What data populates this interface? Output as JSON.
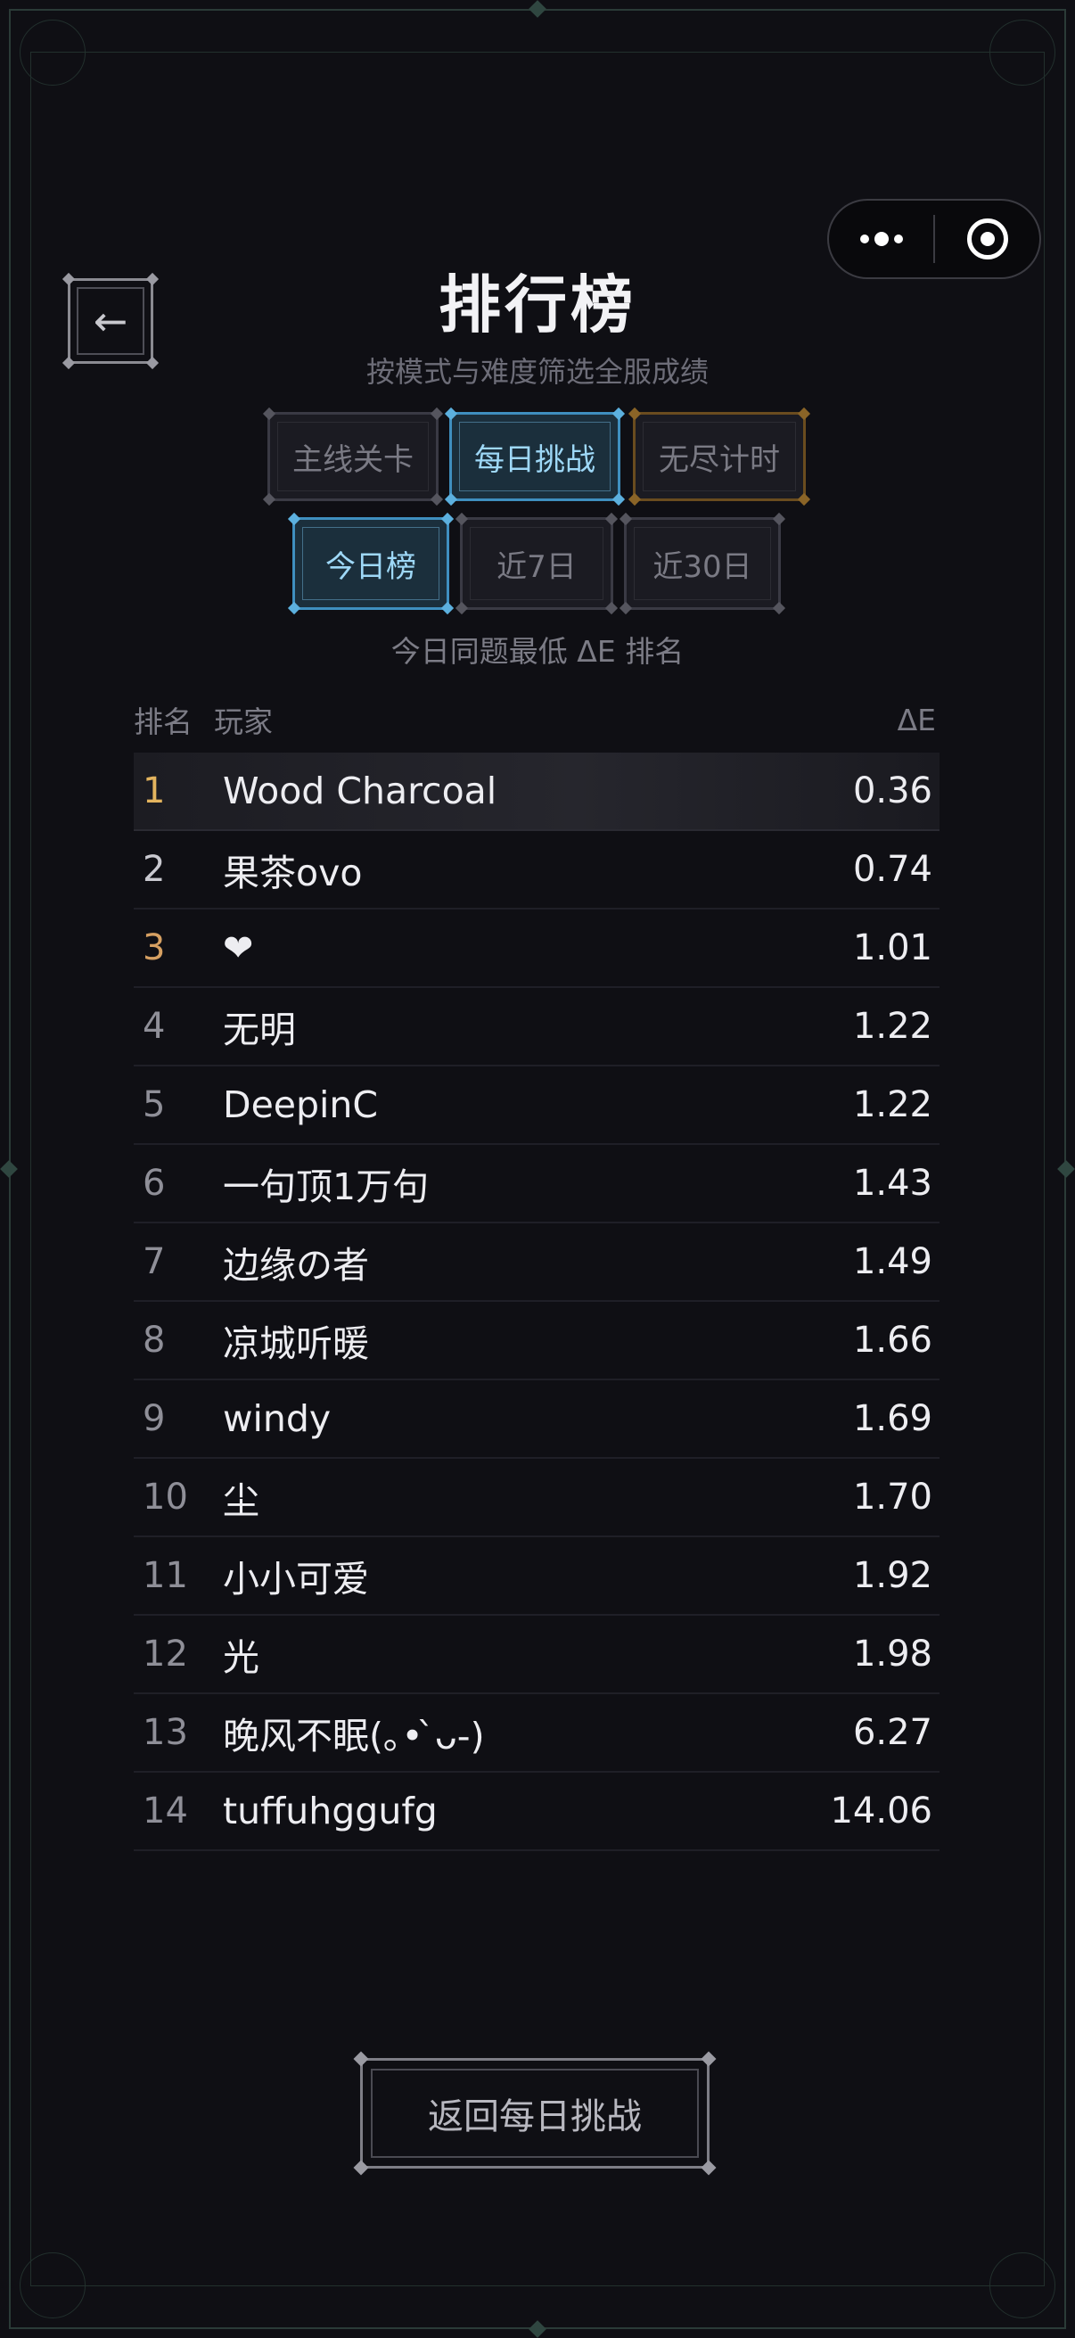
{
  "header": {
    "title": "排行榜",
    "subtitle": "按模式与难度筛选全服成绩",
    "back_icon": "←"
  },
  "mode_tabs": [
    {
      "label": "主线关卡",
      "active": false
    },
    {
      "label": "每日挑战",
      "active": true
    },
    {
      "label": "无尽计时",
      "active": false
    }
  ],
  "range_tabs": [
    {
      "label": "今日榜",
      "active": true
    },
    {
      "label": "近7日",
      "active": false
    },
    {
      "label": "近30日",
      "active": false
    }
  ],
  "range_caption": "今日同题最低 ΔE 排名",
  "table": {
    "headers": {
      "rank": "排名",
      "player": "玩家",
      "delta": "ΔE"
    },
    "rows": [
      {
        "rank": "1",
        "player": "Wood Charcoal",
        "delta": "0.36"
      },
      {
        "rank": "2",
        "player": "果茶ovo",
        "delta": "0.74"
      },
      {
        "rank": "3",
        "player": "❤",
        "delta": "1.01"
      },
      {
        "rank": "4",
        "player": "无明",
        "delta": "1.22"
      },
      {
        "rank": "5",
        "player": "DeepinC",
        "delta": "1.22"
      },
      {
        "rank": "6",
        "player": "一句顶1万句",
        "delta": "1.43"
      },
      {
        "rank": "7",
        "player": "边缘の者",
        "delta": "1.49"
      },
      {
        "rank": "8",
        "player": "凉城听暖",
        "delta": "1.66"
      },
      {
        "rank": "9",
        "player": "windy",
        "delta": "1.69"
      },
      {
        "rank": "10",
        "player": "尘",
        "delta": "1.70"
      },
      {
        "rank": "11",
        "player": "小小可爱",
        "delta": "1.92"
      },
      {
        "rank": "12",
        "player": "光",
        "delta": "1.98"
      },
      {
        "rank": "13",
        "player": "晚风不眠(｡• ̀ᴗ-)",
        "delta": "6.27"
      },
      {
        "rank": "14",
        "player": "tuffuhggufg",
        "delta": "14.06"
      }
    ]
  },
  "bottom_button": {
    "label": "返回每日挑战"
  },
  "colors": {
    "background": "#0f0f14",
    "accent_blue": "#9ed8f7",
    "gold": "#e3b45e",
    "bronze": "#d6a062"
  },
  "icons": {
    "menu": "more-dots-icon",
    "close": "target-icon",
    "back": "back-arrow-icon"
  }
}
